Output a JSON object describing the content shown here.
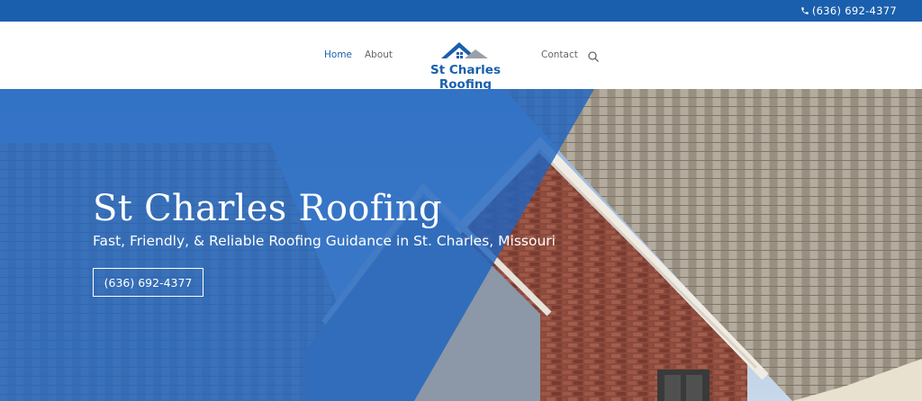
{
  "topbar": {
    "phone": "(636) 692-4377",
    "phone_icon": "phone-icon"
  },
  "nav": {
    "items": [
      {
        "label": "Home",
        "active": true
      },
      {
        "label": "About"
      },
      {
        "label": "Contact"
      }
    ],
    "search_icon": "search-icon"
  },
  "logo": {
    "text": "St Charles Roofing",
    "icon": "house-roof-icon"
  },
  "hero": {
    "title": "St Charles Roofing",
    "subtitle": "Fast, Friendly, & Reliable Roofing Guidance in St. Charles, Missouri",
    "cta_label": "(636) 692-4377"
  },
  "colors": {
    "brand_blue": "#1a5fad",
    "overlay_blue": "#1e64c0",
    "text_white": "#ffffff"
  }
}
